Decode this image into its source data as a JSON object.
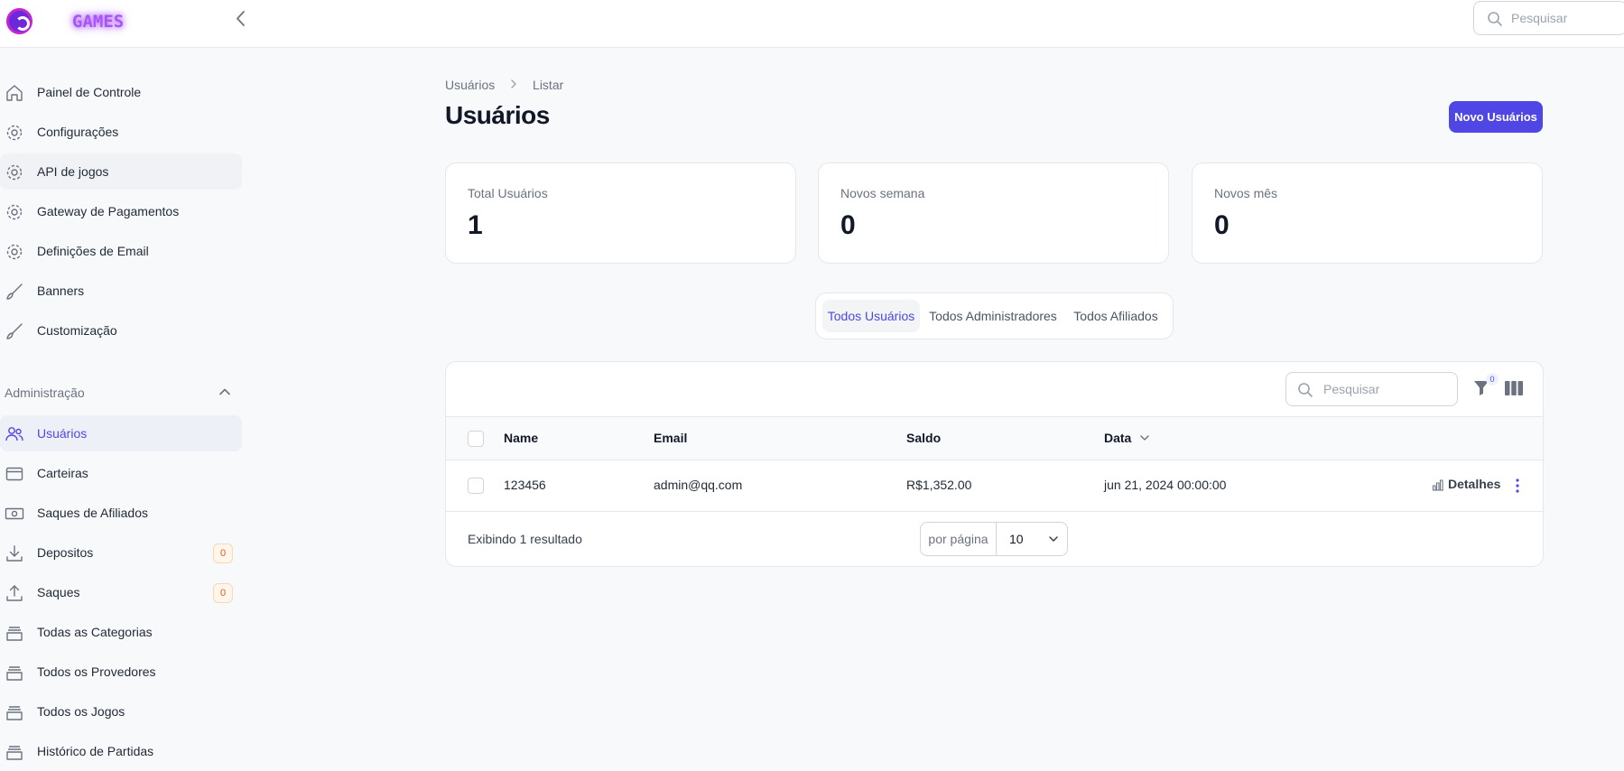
{
  "topbar": {
    "brand": "GAMES",
    "search_placeholder": "Pesquisar"
  },
  "sidebar": {
    "items": [
      {
        "label": "Painel de Controle",
        "icon": "home-icon"
      },
      {
        "label": "Configurações",
        "icon": "gear-icon"
      },
      {
        "label": "API de jogos",
        "icon": "gear-icon"
      },
      {
        "label": "Gateway de Pagamentos",
        "icon": "gear-icon"
      },
      {
        "label": "Definições de Email",
        "icon": "gear-icon"
      },
      {
        "label": "Banners",
        "icon": "brush-icon"
      },
      {
        "label": "Customização",
        "icon": "brush-icon"
      }
    ],
    "group_label": "Administração",
    "admin_items": [
      {
        "label": "Usuários",
        "icon": "users-icon"
      },
      {
        "label": "Carteiras",
        "icon": "wallet-icon"
      },
      {
        "label": "Saques de Afiliados",
        "icon": "cash-icon"
      },
      {
        "label": "Depositos",
        "icon": "download-icon",
        "badge": "0"
      },
      {
        "label": "Saques",
        "icon": "upload-icon",
        "badge": "0"
      },
      {
        "label": "Todas as Categorias",
        "icon": "stack-icon"
      },
      {
        "label": "Todos os Provedores",
        "icon": "stack-icon"
      },
      {
        "label": "Todos os Jogos",
        "icon": "stack-icon"
      },
      {
        "label": "Histórico de Partidas",
        "icon": "stack-icon"
      }
    ]
  },
  "breadcrumb": {
    "parent": "Usuários",
    "current": "Listar"
  },
  "page": {
    "title": "Usuários",
    "new_button": "Novo Usuários"
  },
  "stats": [
    {
      "label": "Total Usuários",
      "value": "1"
    },
    {
      "label": "Novos semana",
      "value": "0"
    },
    {
      "label": "Novos mês",
      "value": "0"
    }
  ],
  "tabs": [
    {
      "label": "Todos Usuários",
      "active": true
    },
    {
      "label": "Todos Administradores",
      "active": false
    },
    {
      "label": "Todos Afiliados",
      "active": false
    }
  ],
  "table": {
    "search_placeholder": "Pesquisar",
    "filter_count": "0",
    "columns": [
      "Name",
      "Email",
      "Saldo",
      "Data"
    ],
    "rows": [
      {
        "name": "123456",
        "email": "admin@qq.com",
        "saldo": "R$1,352.00",
        "data": "jun 21, 2024 00:00:00",
        "action": "Detalhes"
      }
    ],
    "footer_text": "Exibindo 1 resultado",
    "per_page_label": "por página",
    "per_page_value": "10"
  },
  "colors": {
    "accent": "#4f46e5",
    "badge": "#ea580c"
  }
}
